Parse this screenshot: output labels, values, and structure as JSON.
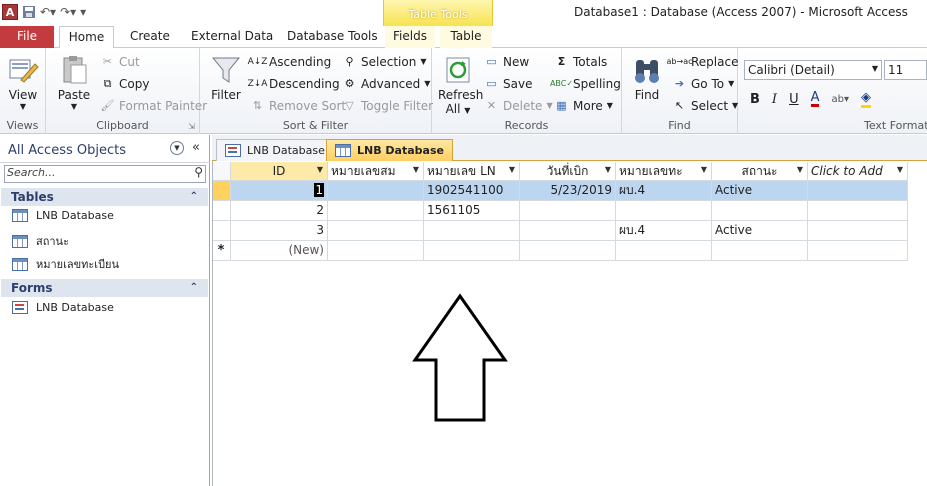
{
  "window": {
    "title": "Database1 : Database (Access 2007)  -  Microsoft Access",
    "app_icon": "A"
  },
  "contextual": {
    "label": "Table Tools"
  },
  "ribbon_tabs": {
    "file": "File",
    "home": "Home",
    "create": "Create",
    "external": "External Data",
    "dbtools": "Database Tools",
    "fields": "Fields",
    "table": "Table"
  },
  "ribbon": {
    "views": {
      "view": "View",
      "label": "Views"
    },
    "clipboard": {
      "paste": "Paste",
      "cut": "Cut",
      "copy": "Copy",
      "format_painter": "Format Painter",
      "label": "Clipboard"
    },
    "sortfilter": {
      "filter": "Filter",
      "ascending": "Ascending",
      "descending": "Descending",
      "remove_sort": "Remove Sort",
      "selection": "Selection",
      "advanced": "Advanced",
      "toggle_filter": "Toggle Filter",
      "label": "Sort & Filter"
    },
    "records": {
      "refresh": "Refresh",
      "refresh_all": "All",
      "new": "New",
      "save": "Save",
      "delete": "Delete",
      "totals": "Totals",
      "spelling": "Spelling",
      "more": "More",
      "label": "Records"
    },
    "find": {
      "find": "Find",
      "replace": "Replace",
      "goto": "Go To",
      "select": "Select",
      "label": "Find"
    },
    "textformat": {
      "font": "Calibri (Detail)",
      "size": "11",
      "label": "Text Formatti"
    }
  },
  "nav": {
    "title": "All Access Objects",
    "search_placeholder": "Search...",
    "tables_label": "Tables",
    "tables": [
      "LNB Database",
      "สถานะ",
      "หมายเลขทะเบียน"
    ],
    "forms_label": "Forms",
    "forms": [
      "LNB Database"
    ]
  },
  "doc_tabs": [
    "LNB Database",
    "LNB Database"
  ],
  "table": {
    "columns": [
      "ID",
      "หมายเลขสม",
      "หมายเลข LN",
      "วันที่เบิก",
      "หมายเลขทะ",
      "สถานะ",
      "Click to Add"
    ],
    "rows": [
      [
        "1",
        "",
        "1902541100",
        "5/23/2019",
        "ผบ.4",
        "Active"
      ],
      [
        "2",
        "",
        "1561105",
        "",
        "",
        ""
      ],
      [
        "3",
        "",
        "",
        "",
        "ผบ.4",
        "Active"
      ]
    ],
    "new_row": "(New)",
    "new_marker": "*"
  }
}
